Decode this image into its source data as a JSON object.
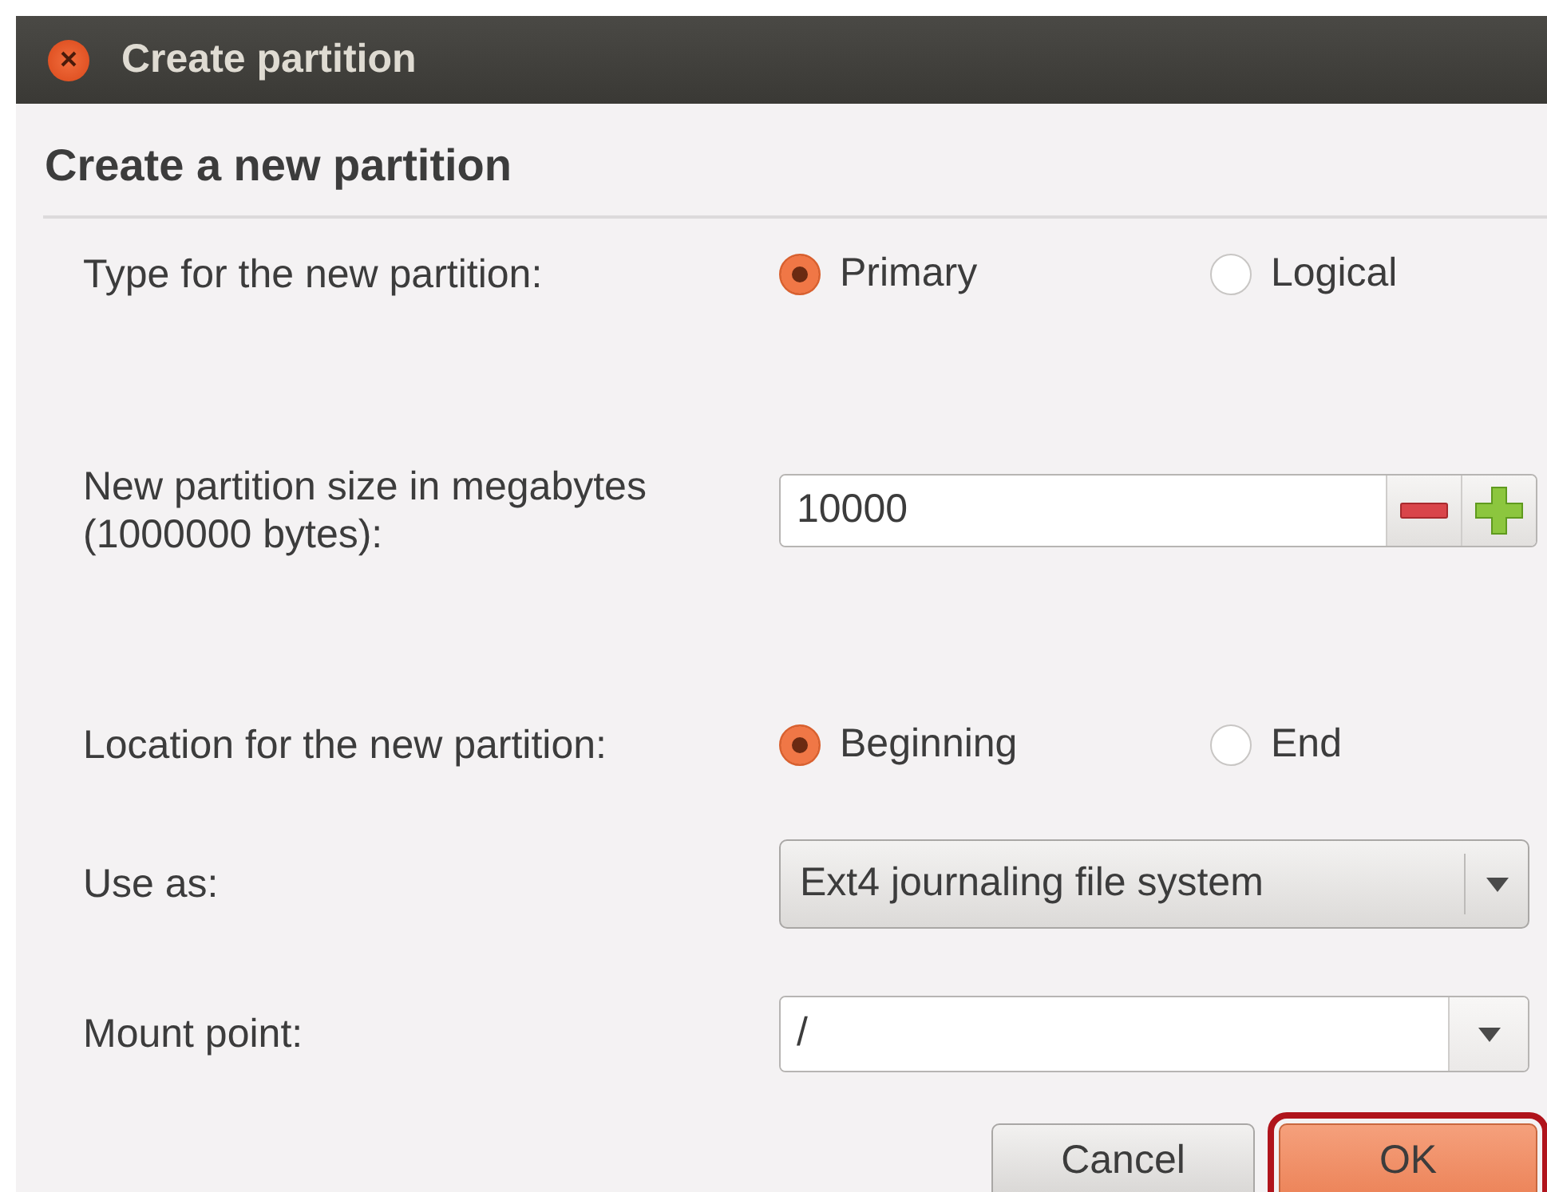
{
  "window": {
    "title": "Create partition"
  },
  "heading": "Create a new partition",
  "fields": [
    {
      "kind": "radio",
      "label": "Type for the new partition:",
      "options": [
        {
          "label": "Primary",
          "selected": true
        },
        {
          "label": "Logical",
          "selected": false
        }
      ]
    },
    {
      "kind": "spin",
      "label": "New partition size in megabytes (1000000 bytes):",
      "value": "10000"
    },
    {
      "kind": "radio",
      "label": "Location for the new partition:",
      "options": [
        {
          "label": "Beginning",
          "selected": true
        },
        {
          "label": "End",
          "selected": false
        }
      ]
    },
    {
      "kind": "combo",
      "label": "Use as:",
      "value": "Ext4 journaling file system"
    },
    {
      "kind": "entry-combo",
      "label": "Mount point:",
      "value": "/"
    }
  ],
  "buttons": [
    {
      "label": "Cancel",
      "highlighted": false
    },
    {
      "label": "OK",
      "highlighted": true
    }
  ]
}
